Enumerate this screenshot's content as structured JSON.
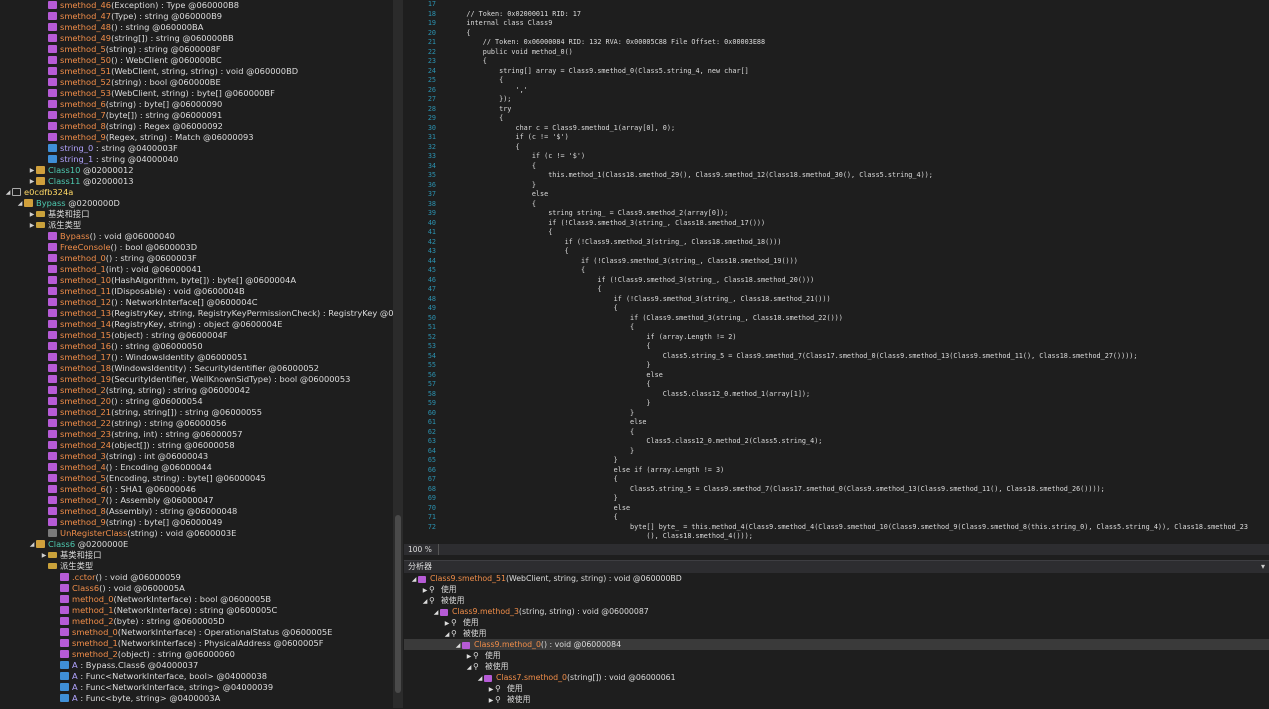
{
  "tree": [
    {
      "ind": 4,
      "tog": "",
      "ic": "m",
      "name": "smethod_46",
      "nc": "",
      "rest": "(Exception) : Type @060000B8"
    },
    {
      "ind": 4,
      "tog": "",
      "ic": "m",
      "name": "smethod_47",
      "nc": "",
      "rest": "(Type) : string @060000B9"
    },
    {
      "ind": 4,
      "tog": "",
      "ic": "m",
      "name": "smethod_48",
      "nc": "",
      "rest": "() : string @060000BA"
    },
    {
      "ind": 4,
      "tog": "",
      "ic": "m",
      "name": "smethod_49",
      "nc": "",
      "rest": "(string[]) : string @060000BB"
    },
    {
      "ind": 4,
      "tog": "",
      "ic": "m",
      "name": "smethod_5",
      "nc": "",
      "rest": "(string) : string @0600008F"
    },
    {
      "ind": 4,
      "tog": "",
      "ic": "m",
      "name": "smethod_50",
      "nc": "",
      "rest": "() : WebClient @060000BC"
    },
    {
      "ind": 4,
      "tog": "",
      "ic": "m",
      "name": "smethod_51",
      "nc": "",
      "rest": "(WebClient, string, string) : void @060000BD"
    },
    {
      "ind": 4,
      "tog": "",
      "ic": "m",
      "name": "smethod_52",
      "nc": "",
      "rest": "(string) : bool @060000BE"
    },
    {
      "ind": 4,
      "tog": "",
      "ic": "m",
      "name": "smethod_53",
      "nc": "",
      "rest": "(WebClient, string) : byte[] @060000BF"
    },
    {
      "ind": 4,
      "tog": "",
      "ic": "m",
      "name": "smethod_6",
      "nc": "",
      "rest": "(string) : byte[] @06000090"
    },
    {
      "ind": 4,
      "tog": "",
      "ic": "m",
      "name": "smethod_7",
      "nc": "",
      "rest": "(byte[]) : string @06000091"
    },
    {
      "ind": 4,
      "tog": "",
      "ic": "m",
      "name": "smethod_8",
      "nc": "",
      "rest": "(string) : Regex @06000092"
    },
    {
      "ind": 4,
      "tog": "",
      "ic": "m",
      "name": "smethod_9",
      "nc": "",
      "rest": "(Regex, string) : Match @06000093"
    },
    {
      "ind": 4,
      "tog": "",
      "ic": "f",
      "name": "string_0",
      "nc": "f",
      "rest": " : string @0400003F"
    },
    {
      "ind": 4,
      "tog": "",
      "ic": "f",
      "name": "string_1",
      "nc": "f",
      "rest": " : string @04000040"
    },
    {
      "ind": 3,
      "tog": "▶",
      "ic": "c",
      "name": "Class10",
      "nc": "t",
      "rest": " @02000012"
    },
    {
      "ind": 3,
      "tog": "▶",
      "ic": "c",
      "name": "Class11",
      "nc": "t",
      "rest": " @02000013"
    },
    {
      "ind": 1,
      "tog": "◢",
      "ic": "ns",
      "name": "e0cdfb324a",
      "nc": "b",
      "rest": ""
    },
    {
      "ind": 2,
      "tog": "◢",
      "ic": "c",
      "name": "Bypass",
      "nc": "t",
      "rest": " @0200000D"
    },
    {
      "ind": 3,
      "tog": "▶",
      "ic": "fo",
      "name": "基类和接口",
      "nc": "w",
      "rest": ""
    },
    {
      "ind": 3,
      "tog": "▶",
      "ic": "fo",
      "name": "派生类型",
      "nc": "w",
      "rest": ""
    },
    {
      "ind": 4,
      "tog": "",
      "ic": "m",
      "name": "Bypass",
      "nc": "",
      "rest": "() : void @06000040"
    },
    {
      "ind": 4,
      "tog": "",
      "ic": "m",
      "name": "FreeConsole",
      "nc": "",
      "rest": "() : bool @0600003D"
    },
    {
      "ind": 4,
      "tog": "",
      "ic": "m",
      "name": "smethod_0",
      "nc": "",
      "rest": "() : string @0600003F"
    },
    {
      "ind": 4,
      "tog": "",
      "ic": "m",
      "name": "smethod_1",
      "nc": "",
      "rest": "(int) : void @06000041"
    },
    {
      "ind": 4,
      "tog": "",
      "ic": "m",
      "name": "smethod_10",
      "nc": "",
      "rest": "(HashAlgorithm, byte[]) : byte[] @0600004A"
    },
    {
      "ind": 4,
      "tog": "",
      "ic": "m",
      "name": "smethod_11",
      "nc": "",
      "rest": "(IDisposable) : void @0600004B"
    },
    {
      "ind": 4,
      "tog": "",
      "ic": "m",
      "name": "smethod_12",
      "nc": "",
      "rest": "() : NetworkInterface[] @0600004C"
    },
    {
      "ind": 4,
      "tog": "",
      "ic": "m",
      "name": "smethod_13",
      "nc": "",
      "rest": "(RegistryKey, string, RegistryKeyPermissionCheck) : RegistryKey @0600004D"
    },
    {
      "ind": 4,
      "tog": "",
      "ic": "m",
      "name": "smethod_14",
      "nc": "",
      "rest": "(RegistryKey, string) : object @0600004E"
    },
    {
      "ind": 4,
      "tog": "",
      "ic": "m",
      "name": "smethod_15",
      "nc": "",
      "rest": "(object) : string @0600004F"
    },
    {
      "ind": 4,
      "tog": "",
      "ic": "m",
      "name": "smethod_16",
      "nc": "",
      "rest": "() : string @06000050"
    },
    {
      "ind": 4,
      "tog": "",
      "ic": "m",
      "name": "smethod_17",
      "nc": "",
      "rest": "() : WindowsIdentity @06000051"
    },
    {
      "ind": 4,
      "tog": "",
      "ic": "m",
      "name": "smethod_18",
      "nc": "",
      "rest": "(WindowsIdentity) : SecurityIdentifier @06000052"
    },
    {
      "ind": 4,
      "tog": "",
      "ic": "m",
      "name": "smethod_19",
      "nc": "",
      "rest": "(SecurityIdentifier, WellKnownSidType) : bool @06000053"
    },
    {
      "ind": 4,
      "tog": "",
      "ic": "m",
      "name": "smethod_2",
      "nc": "",
      "rest": "(string, string) : string @06000042"
    },
    {
      "ind": 4,
      "tog": "",
      "ic": "m",
      "name": "smethod_20",
      "nc": "",
      "rest": "() : string @06000054"
    },
    {
      "ind": 4,
      "tog": "",
      "ic": "m",
      "name": "smethod_21",
      "nc": "",
      "rest": "(string, string[]) : string @06000055"
    },
    {
      "ind": 4,
      "tog": "",
      "ic": "m",
      "name": "smethod_22",
      "nc": "",
      "rest": "(string) : string @06000056"
    },
    {
      "ind": 4,
      "tog": "",
      "ic": "m",
      "name": "smethod_23",
      "nc": "",
      "rest": "(string, int) : string @06000057"
    },
    {
      "ind": 4,
      "tog": "",
      "ic": "m",
      "name": "smethod_24",
      "nc": "",
      "rest": "(object[]) : string @06000058"
    },
    {
      "ind": 4,
      "tog": "",
      "ic": "m",
      "name": "smethod_3",
      "nc": "",
      "rest": "(string) : int @06000043"
    },
    {
      "ind": 4,
      "tog": "",
      "ic": "m",
      "name": "smethod_4",
      "nc": "",
      "rest": "() : Encoding @06000044"
    },
    {
      "ind": 4,
      "tog": "",
      "ic": "m",
      "name": "smethod_5",
      "nc": "",
      "rest": "(Encoding, string) : byte[] @06000045"
    },
    {
      "ind": 4,
      "tog": "",
      "ic": "m",
      "name": "smethod_6",
      "nc": "",
      "rest": "() : SHA1 @06000046"
    },
    {
      "ind": 4,
      "tog": "",
      "ic": "m",
      "name": "smethod_7",
      "nc": "",
      "rest": "() : Assembly @06000047"
    },
    {
      "ind": 4,
      "tog": "",
      "ic": "m",
      "name": "smethod_8",
      "nc": "",
      "rest": "(Assembly) : string @06000048"
    },
    {
      "ind": 4,
      "tog": "",
      "ic": "m",
      "name": "smethod_9",
      "nc": "",
      "rest": "(string) : byte[] @06000049"
    },
    {
      "ind": 4,
      "tog": "",
      "ic": "ev",
      "name": "UnRegisterClass",
      "nc": "",
      "rest": "(string) : void @0600003E"
    },
    {
      "ind": 3,
      "tog": "◢",
      "ic": "c",
      "name": "Class6",
      "nc": "t",
      "rest": " @0200000E"
    },
    {
      "ind": 4,
      "tog": "▶",
      "ic": "fo",
      "name": "基类和接口",
      "nc": "w",
      "rest": ""
    },
    {
      "ind": 4,
      "tog": "",
      "ic": "fo",
      "name": "派生类型",
      "nc": "w",
      "rest": ""
    },
    {
      "ind": 5,
      "tog": "",
      "ic": "m",
      "name": ".cctor",
      "nc": "",
      "rest": "() : void @06000059"
    },
    {
      "ind": 5,
      "tog": "",
      "ic": "m",
      "name": "Class6",
      "nc": "",
      "rest": "() : void @0600005A"
    },
    {
      "ind": 5,
      "tog": "",
      "ic": "m",
      "name": "method_0",
      "nc": "",
      "rest": "(NetworkInterface) : bool @0600005B"
    },
    {
      "ind": 5,
      "tog": "",
      "ic": "m",
      "name": "method_1",
      "nc": "",
      "rest": "(NetworkInterface) : string @0600005C"
    },
    {
      "ind": 5,
      "tog": "",
      "ic": "m",
      "name": "method_2",
      "nc": "",
      "rest": "(byte) : string @0600005D"
    },
    {
      "ind": 5,
      "tog": "",
      "ic": "m",
      "name": "smethod_0",
      "nc": "",
      "rest": "(NetworkInterface) : OperationalStatus @0600005E"
    },
    {
      "ind": 5,
      "tog": "",
      "ic": "m",
      "name": "smethod_1",
      "nc": "",
      "rest": "(NetworkInterface) : PhysicalAddress @0600005F"
    },
    {
      "ind": 5,
      "tog": "",
      "ic": "m",
      "name": "smethod_2",
      "nc": "",
      "rest": "(object) : string @06000060"
    },
    {
      "ind": 5,
      "tog": "",
      "ic": "f",
      "name": "A",
      "nc": "f",
      "rest": " : Bypass.Class6 @04000037"
    },
    {
      "ind": 5,
      "tog": "",
      "ic": "f",
      "name": "A",
      "nc": "f",
      "rest": " : Func<NetworkInterface, bool> @04000038"
    },
    {
      "ind": 5,
      "tog": "",
      "ic": "f",
      "name": "A",
      "nc": "f",
      "rest": " : Func<NetworkInterface, string> @04000039"
    },
    {
      "ind": 5,
      "tog": "",
      "ic": "f",
      "name": "A",
      "nc": "f",
      "rest": " : Func<byte, string> @0400003A"
    }
  ],
  "code": [
    {
      "n": "17",
      "t": ""
    },
    {
      "n": "18",
      "t": "    // Token: 0x02000011 RID: 17"
    },
    {
      "n": "19",
      "t": "    internal class Class9"
    },
    {
      "n": "20",
      "t": "    {"
    },
    {
      "n": "21",
      "t": "        // Token: 0x06000084 RID: 132 RVA: 0x00005C88 File Offset: 0x00003E88"
    },
    {
      "n": "22",
      "t": "        public void method_0()"
    },
    {
      "n": "23",
      "t": "        {"
    },
    {
      "n": "24",
      "t": "            string[] array = Class9.smethod_0(Class5.string_4, new char[]"
    },
    {
      "n": "25",
      "t": "            {"
    },
    {
      "n": "26",
      "t": "                ','"
    },
    {
      "n": "27",
      "t": "            });"
    },
    {
      "n": "28",
      "t": "            try"
    },
    {
      "n": "29",
      "t": "            {"
    },
    {
      "n": "30",
      "t": "                char c = Class9.smethod_1(array[0], 0);"
    },
    {
      "n": "31",
      "t": "                if (c != '$')"
    },
    {
      "n": "32",
      "t": "                {"
    },
    {
      "n": "33",
      "t": "                    if (c != '$')"
    },
    {
      "n": "34",
      "t": "                    {"
    },
    {
      "n": "35",
      "t": "                        this.method_1(Class18.smethod_29(), Class9.smethod_12(Class18.smethod_30(), Class5.string_4));"
    },
    {
      "n": "36",
      "t": "                    }"
    },
    {
      "n": "37",
      "t": "                    else"
    },
    {
      "n": "38",
      "t": "                    {"
    },
    {
      "n": "39",
      "t": "                        string string_ = Class9.smethod_2(array[0]);"
    },
    {
      "n": "40",
      "t": "                        if (!Class9.smethod_3(string_, Class18.smethod_17()))"
    },
    {
      "n": "41",
      "t": "                        {"
    },
    {
      "n": "42",
      "t": "                            if (!Class9.smethod_3(string_, Class18.smethod_18()))"
    },
    {
      "n": "43",
      "t": "                            {"
    },
    {
      "n": "44",
      "t": "                                if (!Class9.smethod_3(string_, Class18.smethod_19()))"
    },
    {
      "n": "45",
      "t": "                                {"
    },
    {
      "n": "46",
      "t": "                                    if (!Class9.smethod_3(string_, Class18.smethod_20()))"
    },
    {
      "n": "47",
      "t": "                                    {"
    },
    {
      "n": "48",
      "t": "                                        if (!Class9.smethod_3(string_, Class18.smethod_21()))"
    },
    {
      "n": "49",
      "t": "                                        {"
    },
    {
      "n": "50",
      "t": "                                            if (Class9.smethod_3(string_, Class18.smethod_22()))"
    },
    {
      "n": "51",
      "t": "                                            {"
    },
    {
      "n": "52",
      "t": "                                                if (array.Length != 2)"
    },
    {
      "n": "53",
      "t": "                                                {"
    },
    {
      "n": "54",
      "t": "                                                    Class5.string_5 = Class9.smethod_7(Class17.smethod_0(Class9.smethod_13(Class9.smethod_11(), Class18.smethod_27())));"
    },
    {
      "n": "55",
      "t": "                                                }"
    },
    {
      "n": "56",
      "t": "                                                else"
    },
    {
      "n": "57",
      "t": "                                                {"
    },
    {
      "n": "58",
      "t": "                                                    Class5.class12_0.method_1(array[1]);"
    },
    {
      "n": "59",
      "t": "                                                }"
    },
    {
      "n": "60",
      "t": "                                            }"
    },
    {
      "n": "61",
      "t": "                                            else"
    },
    {
      "n": "62",
      "t": "                                            {"
    },
    {
      "n": "63",
      "t": "                                                Class5.class12_0.method_2(Class5.string_4);"
    },
    {
      "n": "64",
      "t": "                                            }"
    },
    {
      "n": "65",
      "t": "                                        }"
    },
    {
      "n": "66",
      "t": "                                        else if (array.Length != 3)"
    },
    {
      "n": "67",
      "t": "                                        {"
    },
    {
      "n": "68",
      "t": "                                            Class5.string_5 = Class9.smethod_7(Class17.smethod_0(Class9.smethod_13(Class9.smethod_11(), Class18.smethod_26())));"
    },
    {
      "n": "69",
      "t": "                                        }"
    },
    {
      "n": "70",
      "t": "                                        else"
    },
    {
      "n": "71",
      "t": "                                        {"
    },
    {
      "n": "72",
      "t": "                                            byte[] byte_ = this.method_4(Class9.smethod_4(Class9.smethod_10(Class9.smethod_9(Class9.smethod_8(this.string_0), Class5.string_4)), Class18.smethod_23"
    },
    {
      "n": "",
      "t": "                                                (), Class18.smethod_4()));"
    }
  ],
  "status": {
    "zoom": "100 %"
  },
  "analyzer": {
    "title": "分析器",
    "close": "▾",
    "rows": [
      {
        "ind": 0,
        "tog": "◢",
        "kind": "m",
        "name": "Class9.smethod_51",
        "rest": "(WebClient, string, string) : void @060000BD",
        "sel": false
      },
      {
        "ind": 1,
        "tog": "▶",
        "kind": "mag",
        "name": "",
        "rest": "使用",
        "sel": false
      },
      {
        "ind": 1,
        "tog": "◢",
        "kind": "mag",
        "name": "",
        "rest": "被使用",
        "sel": false
      },
      {
        "ind": 2,
        "tog": "◢",
        "kind": "m",
        "name": "Class9.method_3",
        "rest": "(string, string) : void @06000087",
        "sel": false
      },
      {
        "ind": 3,
        "tog": "▶",
        "kind": "mag",
        "name": "",
        "rest": "使用",
        "sel": false
      },
      {
        "ind": 3,
        "tog": "◢",
        "kind": "mag",
        "name": "",
        "rest": "被使用",
        "sel": false
      },
      {
        "ind": 4,
        "tog": "◢",
        "kind": "m",
        "name": "Class9.method_0",
        "rest": "() : void @06000084",
        "sel": true
      },
      {
        "ind": 5,
        "tog": "▶",
        "kind": "mag",
        "name": "",
        "rest": "使用",
        "sel": false
      },
      {
        "ind": 5,
        "tog": "◢",
        "kind": "mag",
        "name": "",
        "rest": "被使用",
        "sel": false
      },
      {
        "ind": 6,
        "tog": "◢",
        "kind": "m",
        "name": "Class7.smethod_0",
        "rest": "(string[]) : void @06000061",
        "sel": false
      },
      {
        "ind": 7,
        "tog": "▶",
        "kind": "mag",
        "name": "",
        "rest": "使用",
        "sel": false
      },
      {
        "ind": 7,
        "tog": "▶",
        "kind": "mag",
        "name": "",
        "rest": "被使用",
        "sel": false
      }
    ]
  }
}
